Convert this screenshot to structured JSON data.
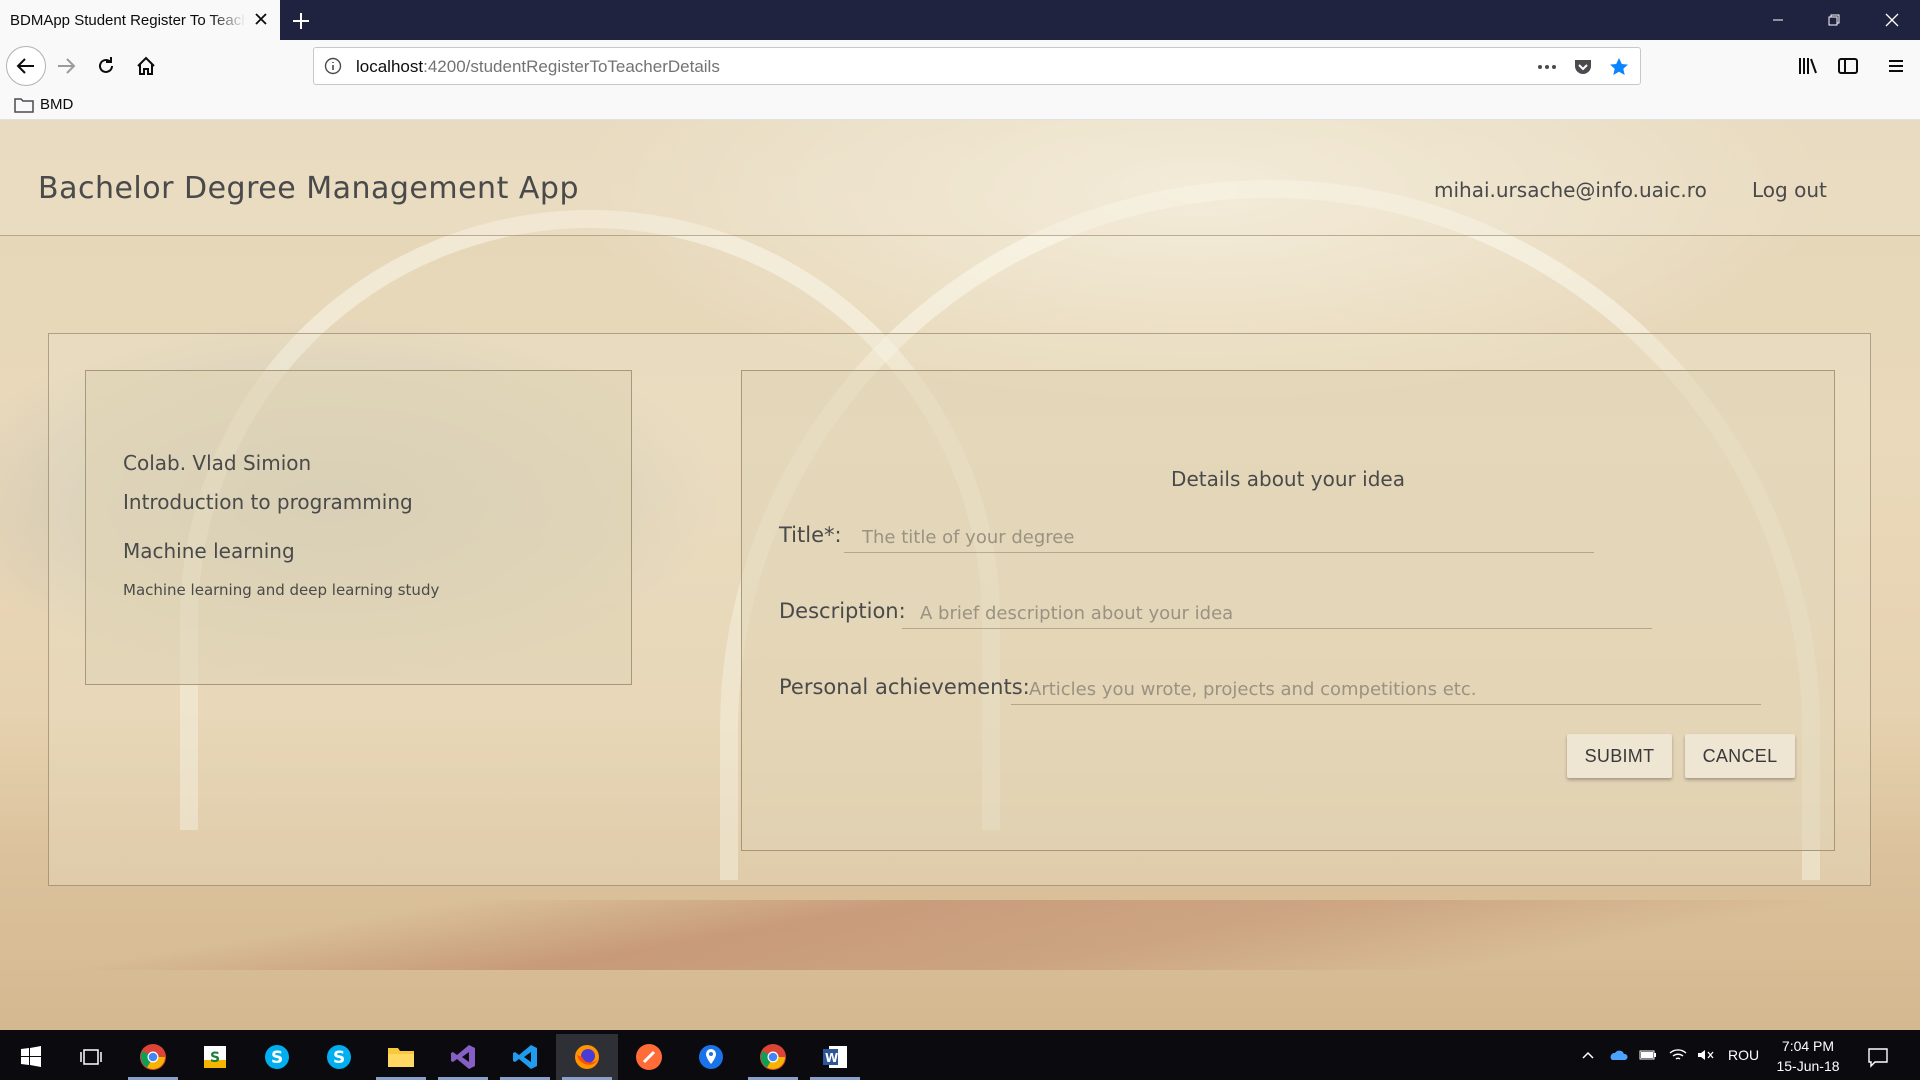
{
  "browser": {
    "tab_title": "BDMApp Student Register To Teacher Details",
    "url_host": "localhost",
    "url_path": ":4200/studentRegisterToTeacherDetails",
    "bookmark_folder": "BMD"
  },
  "header": {
    "app_title": "Bachelor Degree Management App",
    "user_email": "mihai.ursache@info.uaic.ro",
    "logout_label": "Log out"
  },
  "teacher_card": {
    "teacher": "Colab. Vlad Simion",
    "course": "Introduction to programming",
    "topic": "Machine learning",
    "topic_description": "Machine learning and deep learning study"
  },
  "form": {
    "heading": "Details about your idea",
    "title_label": "Title*:",
    "title_placeholder": "The title of your degree",
    "description_label": "Description:",
    "description_placeholder": "A brief description about your idea",
    "achievements_label": "Personal achievements:",
    "achievements_placeholder": "Articles you wrote, projects and competitions etc.",
    "submit_label": "SUBIMT",
    "cancel_label": "CANCEL"
  },
  "taskbar": {
    "language": "ROU",
    "time": "7:04 PM",
    "date": "15-Jun-18",
    "apps": [
      "chrome",
      "stack",
      "skype-blue",
      "skype",
      "file-explorer",
      "visual-studio",
      "vscode",
      "firefox",
      "sublime",
      "maps",
      "chrome",
      "word"
    ]
  }
}
